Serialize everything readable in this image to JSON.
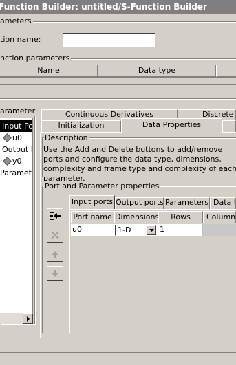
{
  "window": {
    "title": "Function Builder: untitled/S-Function Builder"
  },
  "sections": {
    "parameters_legend": "ameters",
    "name_label": "tion name:",
    "function_name_value": "",
    "function_parameters_legend": "nction parameters",
    "param_table": {
      "columns": [
        "Name",
        "Data type"
      ]
    },
    "tree_legend": "arameter"
  },
  "tree": {
    "items": [
      {
        "label": "Input Por",
        "selected": true,
        "icon": "none"
      },
      {
        "label": "u0",
        "icon": "diamond-icon"
      },
      {
        "label": "Output Po",
        "icon": "none"
      },
      {
        "label": "y0",
        "icon": "diamond-icon"
      },
      {
        "label": "Parameter",
        "icon": "none"
      }
    ]
  },
  "tabs": {
    "row1": [
      "Continuous Derivatives",
      "Discrete U"
    ],
    "row2": [
      "Initialization",
      "Data Properties"
    ],
    "selected": "Data Properties"
  },
  "description": {
    "legend": "Description",
    "text": "Use the Add and Delete buttons to add/remove ports and configure the data type, dimensions, complexity and frame type and complexity of each parameter."
  },
  "ports": {
    "legend": "Port and Parameter properties",
    "subtabs": [
      "Input ports",
      "Output ports",
      "Parameters",
      "Data ty"
    ],
    "selected_subtab": "Input ports",
    "grid_headers": [
      "Port name",
      "Dimensions",
      "Rows",
      "Columns"
    ],
    "rows": [
      {
        "port_name": "u0",
        "dimensions": "1-D",
        "rows": "1",
        "columns": ""
      }
    ]
  }
}
